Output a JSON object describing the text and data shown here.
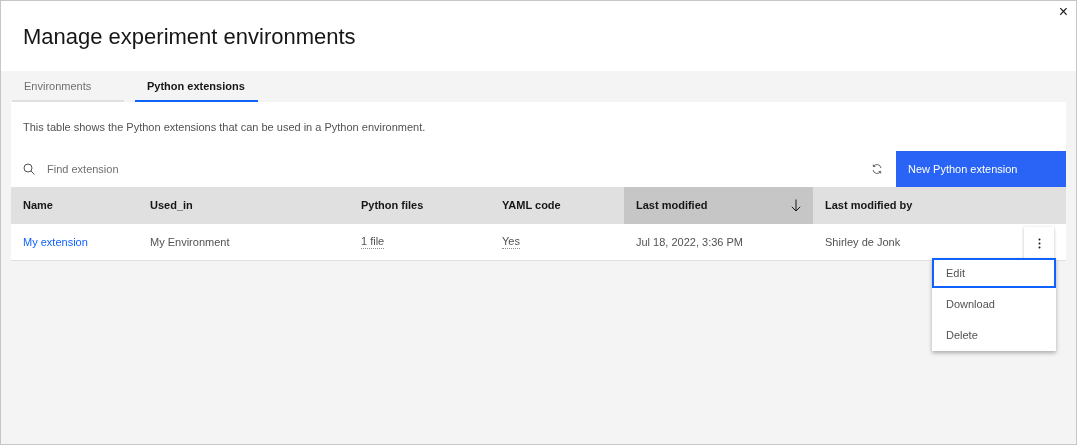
{
  "dialog": {
    "title": "Manage experiment environments",
    "close": "×"
  },
  "tabs": [
    {
      "label": "Environments",
      "selected": false
    },
    {
      "label": "Python extensions",
      "selected": true
    }
  ],
  "description": "This table shows the Python extensions that can be used in a Python environment.",
  "search": {
    "placeholder": "Find extension"
  },
  "primary_button": "New Python extension",
  "table": {
    "columns": [
      {
        "label": "Name",
        "sorted": false
      },
      {
        "label": "Used_in",
        "sorted": false
      },
      {
        "label": "Python files",
        "sorted": false
      },
      {
        "label": "YAML code",
        "sorted": false
      },
      {
        "label": "Last modified",
        "sorted": true
      },
      {
        "label": "Last modified by",
        "sorted": false
      }
    ],
    "rows": [
      {
        "menu_open": true,
        "cells": [
          {
            "kind": "link",
            "text": "My extension"
          },
          {
            "kind": "text",
            "text": "My Environment"
          },
          {
            "kind": "dotted",
            "text": "1 file"
          },
          {
            "kind": "dotted",
            "text": "Yes"
          },
          {
            "kind": "text",
            "text": "Jul 18, 2022, 3:36 PM"
          },
          {
            "kind": "text",
            "text": "Shirley de Jonk"
          }
        ]
      }
    ]
  },
  "overflow_menu": [
    {
      "label": "Edit",
      "focused": true
    },
    {
      "label": "Download",
      "focused": false
    },
    {
      "label": "Delete",
      "focused": false
    }
  ]
}
